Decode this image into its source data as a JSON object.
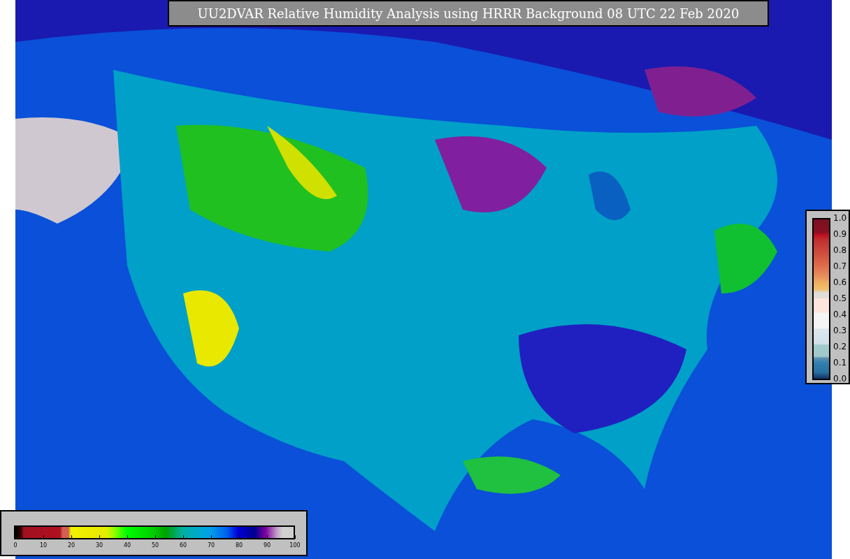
{
  "title": "UU2DVAR Relative Humidity Analysis using HRRR Background 08 UTC 22 Feb 2020",
  "humidity_colorbar": {
    "ticks": [
      "0",
      "10",
      "20",
      "30",
      "40",
      "50",
      "60",
      "70",
      "80",
      "90",
      "100"
    ]
  },
  "observation_colorbar": {
    "ticks": [
      "1.0",
      "0.9",
      "0.8",
      "0.7",
      "0.6",
      "0.5",
      "0.4",
      "0.3",
      "0.2",
      "0.1",
      "0.0"
    ]
  }
}
